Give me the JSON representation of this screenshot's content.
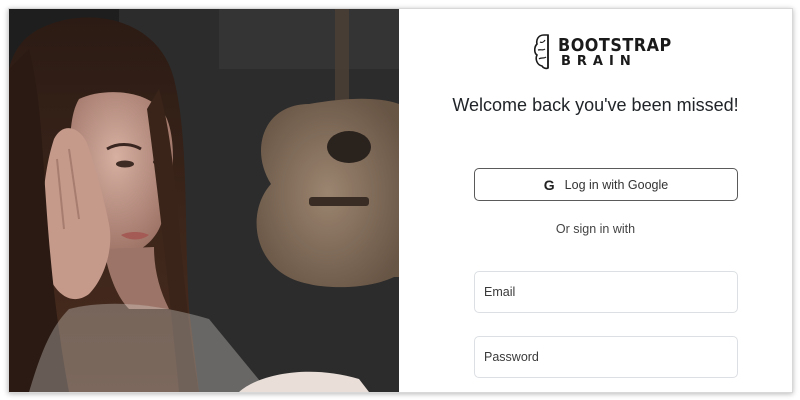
{
  "brand": {
    "name_line1": "BOOTSTRAP",
    "name_line2": "BRAIN"
  },
  "login": {
    "heading": "Welcome back you've been missed!",
    "google_icon": "G",
    "google_label": "Log in with Google",
    "or_text": "Or sign in with",
    "email_placeholder": "Email",
    "password_placeholder": "Password"
  },
  "photo": {
    "description_icon": "woman-at-laptop-photo"
  }
}
